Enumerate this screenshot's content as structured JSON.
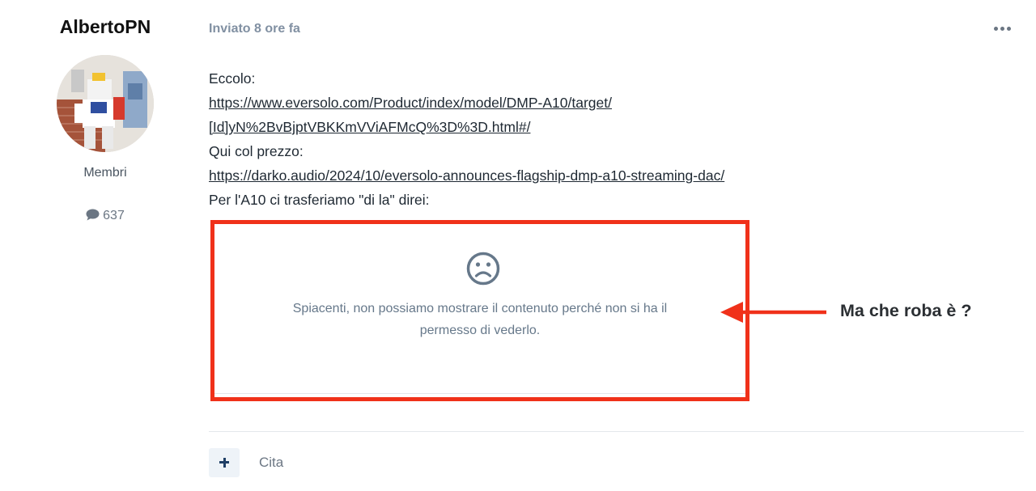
{
  "author": {
    "name": "AlbertoPN",
    "group": "Membri",
    "post_count": "637",
    "avatar_icon": "user-avatar-photo",
    "posts_icon": "comment-icon"
  },
  "post": {
    "meta": "Inviato 8 ore fa",
    "menu_icon": "ellipsis-icon",
    "lines": {
      "line1": "Eccolo:",
      "link1_part1": "https://www.eversolo.com/Product/index/model/DMP-A10/target/",
      "link1_part2": "[Id]yN%2BvBjptVBKKmVViAFMcQ%3D%3D.html#/",
      "line3": "Qui col prezzo:",
      "link2": "https://darko.audio/2024/10/eversolo-announces-flagship-dmp-a10-streaming-dac/",
      "line5": "Per l'A10 ci trasferiamo \"di la\" direi:"
    }
  },
  "blocked_embed": {
    "icon": "sad-face-icon",
    "message_line1": "Spiacenti, non possiamo mostrare il contenuto perché non si ha il",
    "message_line2": "permesso di vederlo.",
    "highlight_color": "#f0311a"
  },
  "annotation": {
    "text": "Ma che roba è ?",
    "arrow_color": "#f0311a"
  },
  "footer": {
    "add_icon": "plus-icon",
    "quote_label": "Cita"
  }
}
